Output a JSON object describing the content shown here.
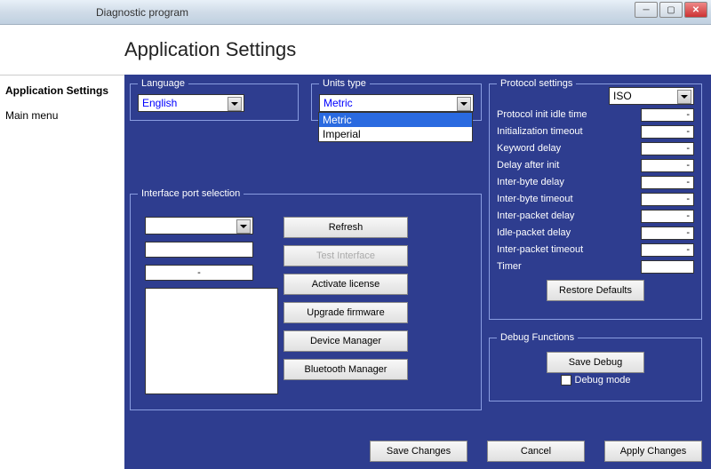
{
  "window": {
    "title": "Diagnostic program"
  },
  "header": {
    "title": "Application Settings"
  },
  "sidebar": {
    "items": [
      {
        "label": "Application Settings",
        "bold": true
      },
      {
        "label": "Main menu",
        "bold": false
      }
    ]
  },
  "language": {
    "legend": "Language",
    "value": "English"
  },
  "units": {
    "legend": "Units type",
    "value": "Metric",
    "options": [
      "Metric",
      "Imperial"
    ],
    "selected_index": 0
  },
  "protocol": {
    "legend": "Protocol settings",
    "combo": "ISO",
    "rows": [
      {
        "label": "Protocol init idle time",
        "value": "-"
      },
      {
        "label": "Initialization timeout",
        "value": "-"
      },
      {
        "label": "Keyword delay",
        "value": "-"
      },
      {
        "label": "Delay after init",
        "value": "-"
      },
      {
        "label": "Inter-byte delay",
        "value": "-"
      },
      {
        "label": "Inter-byte timeout",
        "value": "-"
      },
      {
        "label": "Inter-packet delay",
        "value": "-"
      },
      {
        "label": "Idle-packet delay",
        "value": "-"
      },
      {
        "label": "Inter-packet timeout",
        "value": "-"
      },
      {
        "label": "Timer",
        "value": ""
      }
    ],
    "restore": "Restore Defaults"
  },
  "port": {
    "legend": "Interface port selection",
    "field2": "",
    "field3": "-",
    "buttons": {
      "refresh": "Refresh",
      "test": "Test Interface",
      "activate": "Activate license",
      "upgrade": "Upgrade firmware",
      "devmgr": "Device Manager",
      "btmgr": "Bluetooth Manager"
    }
  },
  "debug": {
    "legend": "Debug Functions",
    "save": "Save Debug",
    "mode": "Debug mode"
  },
  "bottom": {
    "save": "Save Changes",
    "cancel": "Cancel",
    "apply": "Apply Changes"
  }
}
